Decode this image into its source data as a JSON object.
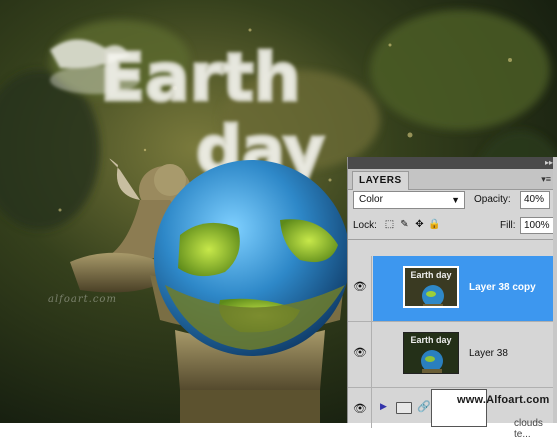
{
  "artwork": {
    "headline_line1": "Earth",
    "headline_line2": "day",
    "watermark": "alfoart.com"
  },
  "layers_panel": {
    "tab_label": "LAYERS",
    "collapse_icon": "double-chevron-right-icon",
    "menu_icon": "panel-menu-icon",
    "blend_mode": "Color",
    "opacity_label": "Opacity:",
    "opacity_value": "40%",
    "lock_label": "Lock:",
    "lock_icons": [
      "lock-transparent-icon",
      "lock-image-icon",
      "lock-position-icon",
      "lock-all-icon"
    ],
    "fill_label": "Fill:",
    "fill_value": "100%",
    "layers": [
      {
        "name": "Layer 38 copy",
        "visible": true,
        "selected": true,
        "thumb_title": "Earth day"
      },
      {
        "name": "Layer 38",
        "visible": true,
        "selected": false,
        "thumb_title": "Earth day"
      },
      {
        "name": "clouds te...",
        "visible": true,
        "selected": false,
        "group": true
      }
    ],
    "selection_color": "#3d97ef"
  },
  "site_watermark": "www.Alfoart.com"
}
